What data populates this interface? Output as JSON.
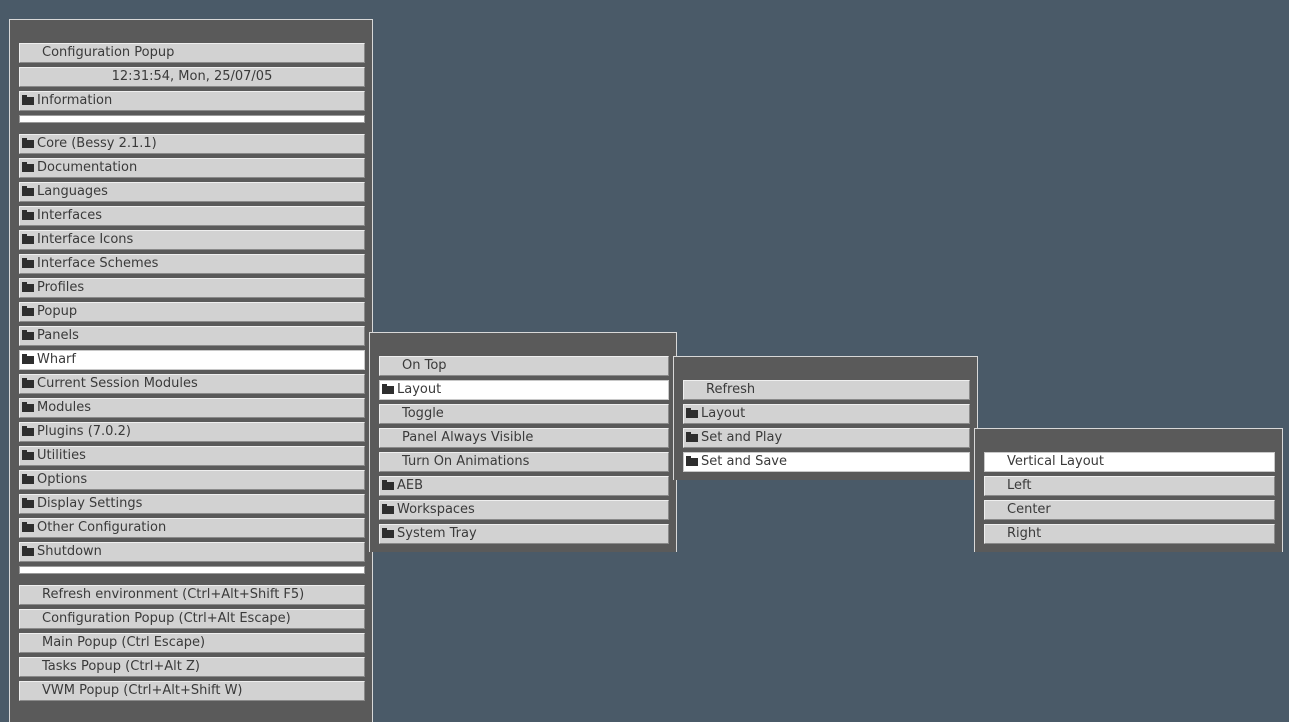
{
  "menu1": {
    "items": [
      {
        "label": "Configuration Popup",
        "style": "indent"
      },
      {
        "label": "12:31:54, Mon, 25/07/05",
        "style": "center"
      },
      {
        "label": "Information",
        "folder": true
      },
      {
        "separator": true
      },
      {
        "label": "Core (Bessy 2.1.1)",
        "folder": true
      },
      {
        "label": "Documentation",
        "folder": true
      },
      {
        "label": "Languages",
        "folder": true
      },
      {
        "label": "Interfaces",
        "folder": true
      },
      {
        "label": "Interface Icons",
        "folder": true
      },
      {
        "label": "Interface Schemes",
        "folder": true
      },
      {
        "label": "Profiles",
        "folder": true
      },
      {
        "label": "Popup",
        "folder": true
      },
      {
        "label": "Panels",
        "folder": true
      },
      {
        "label": "Wharf",
        "folder": true,
        "active": true
      },
      {
        "label": "Current Session Modules",
        "folder": true
      },
      {
        "label": "Modules",
        "folder": true
      },
      {
        "label": "Plugins (7.0.2)",
        "folder": true
      },
      {
        "label": "Utilities",
        "folder": true
      },
      {
        "label": "Options",
        "folder": true
      },
      {
        "label": "Display Settings",
        "folder": true
      },
      {
        "label": "Other Configuration",
        "folder": true
      },
      {
        "label": "Shutdown",
        "folder": true
      },
      {
        "separator": true
      },
      {
        "label": "Refresh environment (Ctrl+Alt+Shift F5)",
        "style": "indent"
      },
      {
        "label": "Configuration Popup (Ctrl+Alt Escape)",
        "style": "indent"
      },
      {
        "label": "Main Popup (Ctrl Escape)",
        "style": "indent"
      },
      {
        "label": "Tasks Popup (Ctrl+Alt Z)",
        "style": "indent"
      },
      {
        "label": "VWM Popup (Ctrl+Alt+Shift W)",
        "style": "indent"
      }
    ]
  },
  "menu2": {
    "items": [
      {
        "label": "On Top",
        "style": "indent"
      },
      {
        "label": "Layout",
        "folder": true,
        "active": true
      },
      {
        "label": "Toggle",
        "style": "indent"
      },
      {
        "label": "Panel Always Visible",
        "style": "indent"
      },
      {
        "label": "Turn On Animations",
        "style": "indent"
      },
      {
        "label": "AEB",
        "folder": true
      },
      {
        "label": "Workspaces",
        "folder": true
      },
      {
        "label": "System Tray",
        "folder": true
      }
    ]
  },
  "menu3": {
    "items": [
      {
        "label": "Refresh",
        "style": "indent"
      },
      {
        "label": "Layout",
        "folder": true
      },
      {
        "label": "Set and Play",
        "folder": true
      },
      {
        "label": "Set and Save",
        "folder": true,
        "active": true
      }
    ]
  },
  "menu4": {
    "items": [
      {
        "label": "Vertical Layout",
        "style": "indent",
        "active": true
      },
      {
        "label": "Left",
        "style": "indent"
      },
      {
        "label": "Center",
        "style": "indent"
      },
      {
        "label": "Right",
        "style": "indent"
      }
    ]
  },
  "colors": {
    "desktop": "#4a5a68",
    "menu_frame": "#5a5a5a",
    "item": "#d2d2d2",
    "item_active": "#ffffff"
  },
  "icons": {
    "folder": "folder-icon"
  }
}
